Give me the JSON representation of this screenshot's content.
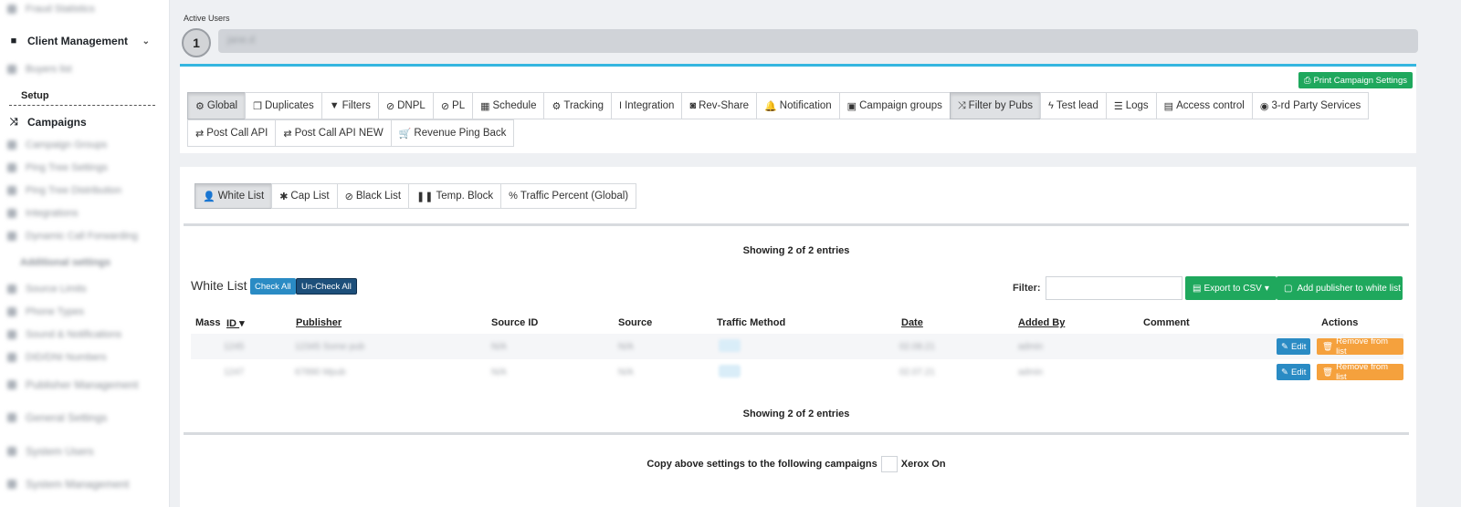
{
  "sidebar": {
    "blurred_top": "Fraud Statistics",
    "client_management": "Client Management",
    "blurred_1": "Buyers list",
    "setup": "Setup",
    "campaigns": "Campaigns",
    "blurred_items": [
      "Campaign Groups",
      "Ping Tree Settings",
      "Ping Tree Distribution",
      "Integrations",
      "Dynamic Call Forwarding"
    ],
    "blurred_section": "Additional settings",
    "blurred_items2": [
      "Source Limits",
      "Phone Types",
      "Sound & Notifications",
      "DID/DNI Numbers"
    ],
    "blurred_groups": [
      "Publisher Management",
      "General Settings",
      "System Users",
      "System Management"
    ]
  },
  "active_users": {
    "label": "Active Users",
    "count": "1",
    "user_blurred": "jane.d"
  },
  "print_button": "Print Campaign Settings",
  "tabs_row1": [
    {
      "label": "Global",
      "icon": "gears-icon",
      "glyph": "⚙",
      "active": true
    },
    {
      "label": "Duplicates",
      "icon": "copy-icon",
      "glyph": "❐",
      "active": false
    },
    {
      "label": "Filters",
      "icon": "filter-icon",
      "glyph": "▼",
      "active": false
    },
    {
      "label": "DNPL",
      "icon": "ban-icon",
      "glyph": "⊘",
      "active": false
    },
    {
      "label": "PL",
      "icon": "ban-icon",
      "glyph": "⊘",
      "active": false
    },
    {
      "label": "Schedule",
      "icon": "calendar-icon",
      "glyph": "▦",
      "active": false
    },
    {
      "label": "Tracking",
      "icon": "gears-icon",
      "glyph": "⚙",
      "active": false
    },
    {
      "label": "Integration",
      "icon": "cursor-icon",
      "glyph": "I",
      "active": false
    },
    {
      "label": "Rev-Share",
      "icon": "money-icon",
      "glyph": "◙",
      "active": false
    },
    {
      "label": "Notification",
      "icon": "bell-icon",
      "glyph": "🔔",
      "active": false
    },
    {
      "label": "Campaign groups",
      "icon": "object-group-icon",
      "glyph": "▣",
      "active": false
    },
    {
      "label": "Filter by Pubs",
      "icon": "random-icon",
      "glyph": "⤨",
      "active": true
    },
    {
      "label": "Test lead",
      "icon": "bolt-icon",
      "glyph": "ϟ",
      "active": false
    },
    {
      "label": "Logs",
      "icon": "list-icon",
      "glyph": "☰",
      "active": false
    },
    {
      "label": "Access control",
      "icon": "file-icon",
      "glyph": "▤",
      "active": false
    },
    {
      "label": "3-rd Party Services",
      "icon": "eye-icon",
      "glyph": "◉",
      "active": false
    }
  ],
  "tabs_row2": [
    {
      "label": "Post Call API",
      "icon": "exchange-icon",
      "glyph": "⇄"
    },
    {
      "label": "Post Call API NEW",
      "icon": "exchange-icon",
      "glyph": "⇄"
    },
    {
      "label": "Revenue Ping Back",
      "icon": "cart-icon",
      "glyph": "🛒"
    }
  ],
  "subtabs": [
    {
      "label": "White List",
      "icon": "user-plus-icon",
      "glyph": "👤",
      "active": true
    },
    {
      "label": "Cap List",
      "icon": "cog-icon",
      "glyph": "✱",
      "active": false
    },
    {
      "label": "Black List",
      "icon": "ban-icon",
      "glyph": "⊘",
      "active": false
    },
    {
      "label": "Temp. Block",
      "icon": "pause-icon",
      "glyph": "❚❚",
      "active": false
    },
    {
      "label": "Traffic Percent (Global)",
      "icon": "percent-icon",
      "glyph": "%",
      "active": false
    }
  ],
  "showing_top": "Showing 2 of 2 entries",
  "showing_bottom": "Showing 2 of 2 entries",
  "white_list": {
    "title": "White List",
    "check_all": "Check All",
    "uncheck_all": "Un-Check All",
    "filter_label": "Filter:",
    "filter_value": "",
    "export_label": "Export to CSV",
    "add_label": "Add publisher to white list"
  },
  "table": {
    "headers": {
      "mass": "Mass",
      "id": "ID",
      "publisher": "Publisher",
      "source_id": "Source ID",
      "source": "Source",
      "traffic_method": "Traffic Method",
      "date": "Date",
      "added_by": "Added By",
      "comment": "Comment",
      "actions": "Actions"
    },
    "rows": [
      {
        "id": "1245",
        "publisher": "12345 Some pub",
        "source_id": "N/A",
        "source": "N/A",
        "date": "02.08.21",
        "added_by": "admin"
      },
      {
        "id": "1247",
        "publisher": "67890 Mpub",
        "source_id": "N/A",
        "source": "N/A",
        "date": "02.07.21",
        "added_by": "admin"
      }
    ],
    "edit_label": "Edit",
    "remove_label": "Remove from list"
  },
  "copy_settings": {
    "label": "Copy above settings to the following campaigns",
    "xerox": "Xerox On"
  },
  "colors": {
    "accent_blue": "#35b6e0",
    "green": "#1fa85d",
    "edit_blue": "#2a8bc4",
    "orange": "#f5a13d",
    "dark_navy": "#1d4f7a"
  }
}
